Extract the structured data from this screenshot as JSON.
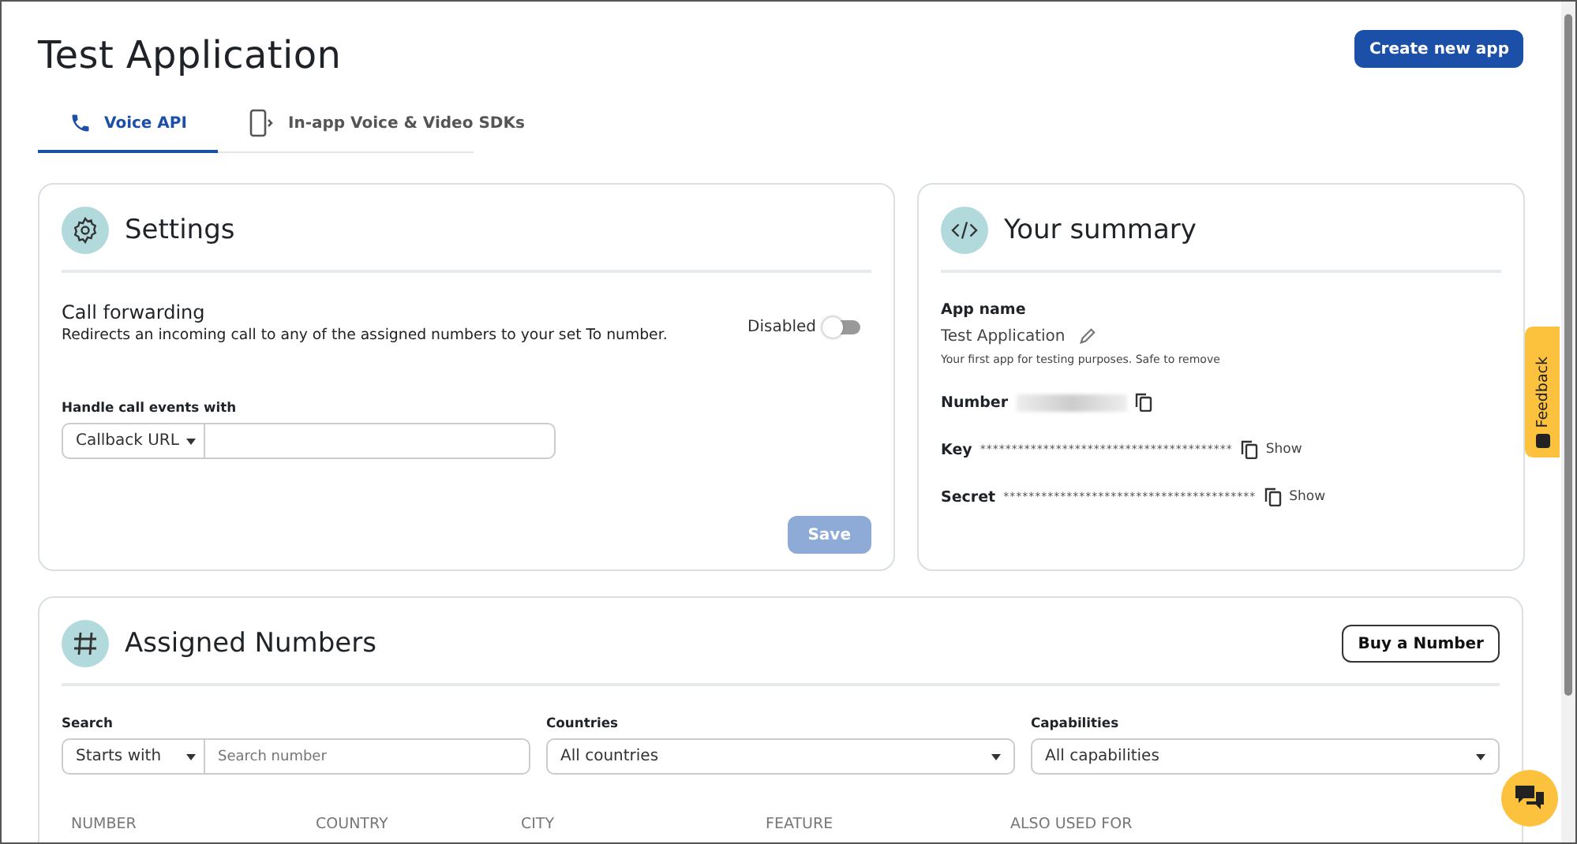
{
  "header": {
    "title": "Test Application",
    "create_button": "Create new app"
  },
  "tabs": [
    {
      "label": "Voice API",
      "kind": "phone",
      "selected": true
    },
    {
      "label": "In-app Voice & Video SDKs",
      "kind": "device",
      "selected": false
    }
  ],
  "settings": {
    "title": "Settings",
    "call_forwarding": {
      "title": "Call forwarding",
      "description": "Redirects an incoming call to any of the assigned numbers to your set To number.",
      "toggle_label": "Disabled",
      "on": false
    },
    "handle_label": "Handle call events with",
    "handle_select": "Callback URL",
    "save_button": "Save",
    "save_disabled": true
  },
  "summary": {
    "title": "Your summary",
    "app_name_label": "App name",
    "app_name": "Test Application",
    "app_note": "Your first app for testing purposes. Safe to remove",
    "number_label": "Number",
    "secrets": [
      {
        "label": "Key",
        "value": "****************************************",
        "show": "Show"
      },
      {
        "label": "Secret",
        "value": "****************************************",
        "show": "Show"
      }
    ]
  },
  "assigned": {
    "title": "Assigned Numbers",
    "buy_button": "Buy a Number",
    "search_label": "Search",
    "search_mode": "Starts with",
    "search_placeholder": "Search number",
    "countries_label": "Countries",
    "countries_value": "All countries",
    "capabilities_label": "Capabilities",
    "capabilities_value": "All capabilities",
    "columns": [
      "NUMBER",
      "COUNTRY",
      "CITY",
      "FEATURE",
      "ALSO USED FOR"
    ]
  },
  "feedback": "Feedback"
}
